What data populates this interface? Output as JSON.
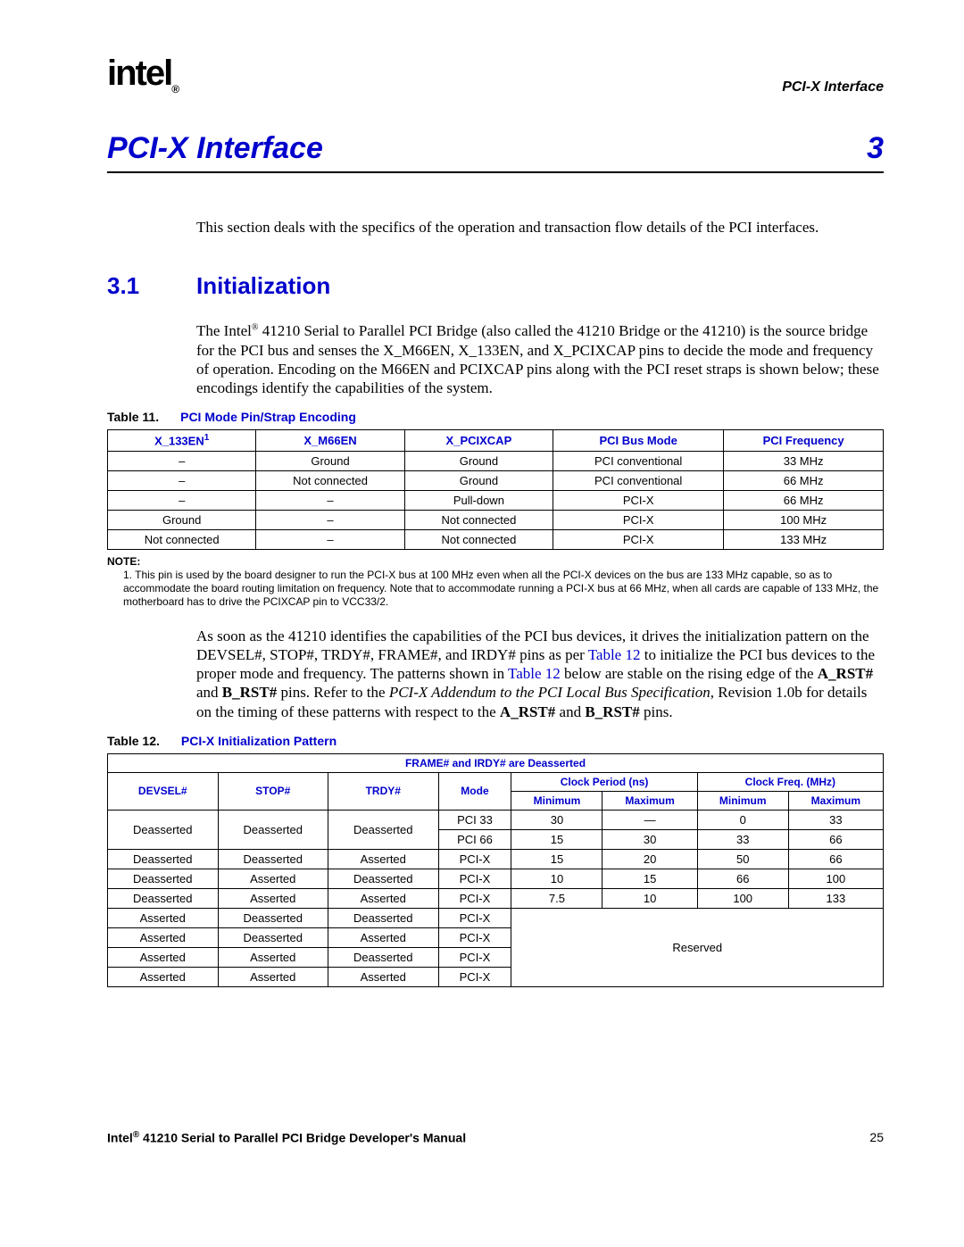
{
  "header": {
    "logo_text": "intel",
    "logo_reg": "®",
    "running_head": "PCI-X Interface"
  },
  "chapter": {
    "title": "PCI-X Interface",
    "number": "3"
  },
  "intro": "This section deals with the specifics of the operation and transaction flow details of the PCI interfaces.",
  "section31": {
    "num": "3.1",
    "title": "Initialization",
    "para_pre": "The Intel",
    "para_reg": "®",
    "para_post": " 41210 Serial to Parallel PCI Bridge (also called the 41210 Bridge or the 41210) is the source bridge for the PCI bus and senses the X_M66EN, X_133EN, and X_PCIXCAP pins to decide the mode and frequency of operation. Encoding on the M66EN and PCIXCAP pins along with the PCI reset straps is shown below; these encodings identify the capabilities of the system."
  },
  "table11": {
    "caption_label": "Table 11.",
    "caption_title": "PCI Mode Pin/Strap Encoding",
    "headers": {
      "h1_pre": "X_133EN",
      "h1_sup": "1",
      "h2": "X_M66EN",
      "h3": "X_PCIXCAP",
      "h4": "PCI Bus Mode",
      "h5": "PCI Frequency"
    },
    "rows": [
      {
        "c1": "–",
        "c2": "Ground",
        "c3": "Ground",
        "c4": "PCI conventional",
        "c5": "33 MHz"
      },
      {
        "c1": "–",
        "c2": "Not connected",
        "c3": "Ground",
        "c4": "PCI conventional",
        "c5": "66 MHz"
      },
      {
        "c1": "–",
        "c2": "–",
        "c3": "Pull-down",
        "c4": "PCI-X",
        "c5": "66 MHz"
      },
      {
        "c1": "Ground",
        "c2": "–",
        "c3": "Not connected",
        "c4": "PCI-X",
        "c5": "100 MHz"
      },
      {
        "c1": "Not connected",
        "c2": "–",
        "c3": "Not connected",
        "c4": "PCI-X",
        "c5": "133 MHz"
      }
    ],
    "note_label": "NOTE:",
    "note_text": "1. This pin is used by the board designer to run the PCI-X bus at 100 MHz even when all the PCI-X devices on the bus are 133 MHz capable, so as to accommodate the board routing limitation on frequency. Note that to accommodate running a PCI-X bus at 66 MHz, when all cards are capable of 133 MHz, the motherboard has to drive the PCIXCAP pin to VCC33/2."
  },
  "mid_para": {
    "s1": "As soon as the 41210 identifies the capabilities of the PCI bus devices, it drives the initialization pattern on the DEVSEL#, STOP#, TRDY#, FRAME#, and IRDY# pins as per ",
    "ref1": "Table 12",
    "s2": " to initialize the PCI bus devices to the proper mode and frequency. The patterns shown in ",
    "ref2": "Table 12",
    "s3": " below are stable on the rising edge of the ",
    "b1": "A_RST#",
    "s4": " and ",
    "b2": "B_RST#",
    "s5": " pins. Refer to the ",
    "i1": "PCI-X Addendum to the PCI Local Bus Specification",
    "s6": ", Revision 1.0b for details on the timing of these patterns with respect to the ",
    "b3": "A_RST#",
    "s7": " and ",
    "b4": "B_RST#",
    "s8": " pins."
  },
  "table12": {
    "caption_label": "Table 12.",
    "caption_title": "PCI-X Initialization Pattern",
    "super_header": "FRAME# and IRDY# are Deasserted",
    "headers": {
      "h1": "DEVSEL#",
      "h2": "STOP#",
      "h3": "TRDY#",
      "h4": "Mode",
      "h5": "Clock Period (ns)",
      "h6": "Clock Freq. (MHz)",
      "hmin": "Minimum",
      "hmax": "Maximum"
    },
    "rows_top": [
      {
        "c1": "Deasserted",
        "c2": "Deasserted",
        "c3": "Deasserted",
        "c4": "PCI 33",
        "pmin": "30",
        "pmax": "—",
        "fmin": "0",
        "fmax": "33",
        "rs": true
      },
      {
        "c4b": "PCI 66",
        "pmin": "15",
        "pmax": "30",
        "fmin": "33",
        "fmax": "66"
      },
      {
        "c1": "Deasserted",
        "c2": "Deasserted",
        "c3": "Asserted",
        "c4": "PCI-X",
        "pmin": "15",
        "pmax": "20",
        "fmin": "50",
        "fmax": "66"
      },
      {
        "c1": "Deasserted",
        "c2": "Asserted",
        "c3": "Deasserted",
        "c4": "PCI-X",
        "pmin": "10",
        "pmax": "15",
        "fmin": "66",
        "fmax": "100"
      },
      {
        "c1": "Deasserted",
        "c2": "Asserted",
        "c3": "Asserted",
        "c4": "PCI-X",
        "pmin": "7.5",
        "pmax": "10",
        "fmin": "100",
        "fmax": "133"
      }
    ],
    "rows_bottom": [
      {
        "c1": "Asserted",
        "c2": "Deasserted",
        "c3": "Deasserted",
        "c4": "PCI-X"
      },
      {
        "c1": "Asserted",
        "c2": "Deasserted",
        "c3": "Asserted",
        "c4": "PCI-X"
      },
      {
        "c1": "Asserted",
        "c2": "Asserted",
        "c3": "Deasserted",
        "c4": "PCI-X"
      },
      {
        "c1": "Asserted",
        "c2": "Asserted",
        "c3": "Asserted",
        "c4": "PCI-X"
      }
    ],
    "reserved": "Reserved"
  },
  "footer": {
    "title_pre": "Intel",
    "title_reg": "®",
    "title_post": " 41210 Serial to Parallel PCI Bridge Developer's Manual",
    "page_num": "25"
  }
}
